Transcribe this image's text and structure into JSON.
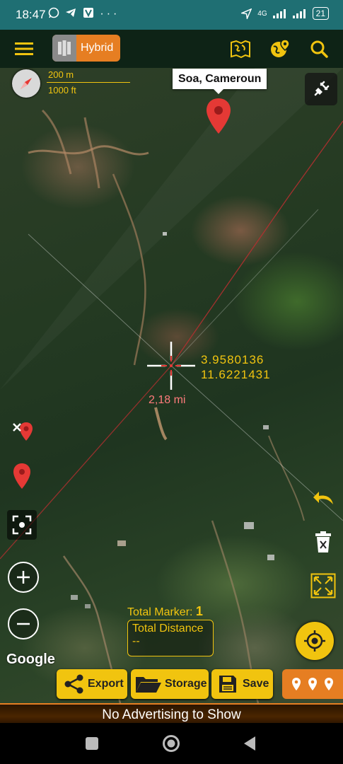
{
  "status_bar": {
    "time": "18:47",
    "network": "4G",
    "battery": "21"
  },
  "toolbar": {
    "map_type_label": "Hybrid"
  },
  "map": {
    "scale_metric": "200 m",
    "scale_imperial": "1000 ft",
    "marker_callout": "Soa, Cameroun",
    "crosshair_lat": "3.9580136",
    "crosshair_lng": "11.6221431",
    "distance_to_marker": "2,18 mi",
    "attribution": "Google"
  },
  "stats": {
    "total_marker_label": "Total Marker:",
    "total_marker_value": "1",
    "total_distance_label": "Total Distance",
    "total_distance_value": "--"
  },
  "actions": {
    "export_label": "Export",
    "storage_label": "Storage",
    "save_label": "Save"
  },
  "ad_bar": {
    "text": "No Advertising to Show"
  },
  "colors": {
    "accent_yellow": "#f1c40f",
    "accent_orange": "#e67e22",
    "toolbar_bg": "#0e2316",
    "statusbar_bg": "#1f6f73",
    "marker_red": "#e53935"
  }
}
